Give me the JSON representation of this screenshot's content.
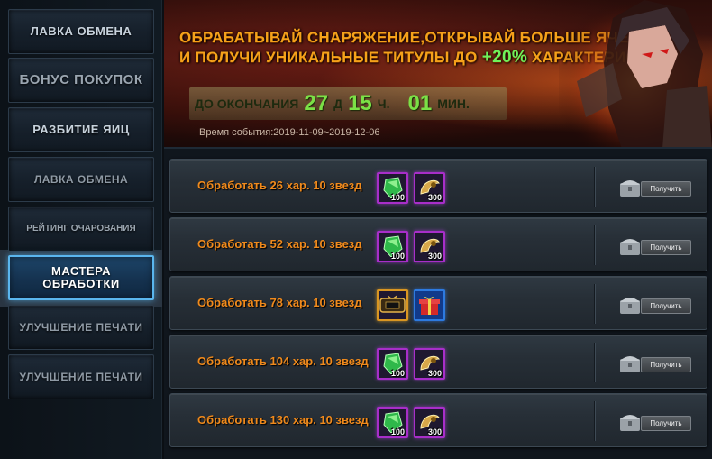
{
  "sidebar": {
    "items": [
      {
        "label": "ЛАВКА ОБМЕНА"
      },
      {
        "label": "БОНУС ПОКУПОК"
      },
      {
        "label": "РАЗБИТИЕ ЯИЦ"
      },
      {
        "label": "ЛАВКА ОБМЕНА"
      },
      {
        "label": "РЕЙТИНГ ОЧАРОВАНИЯ"
      },
      {
        "label": "МАСТЕРА ОБРАБОТКИ"
      },
      {
        "label": "УЛУЧШЕНИЕ ПЕЧАТИ"
      },
      {
        "label": "УЛУЧШЕНИЕ ПЕЧАТИ"
      }
    ],
    "active_index": 5
  },
  "banner": {
    "line1": "ОБРАБАТЫВАЙ СНАРЯЖЕНИЕ,ОТКРЫВАЙ БОЛЬШЕ ЯЧЕЕК",
    "line2_prefix": "И ПОЛУЧИ УНИКАЛЬНЫЕ  ТИТУЛЫ ДО ",
    "line2_pct": "+20%",
    "line2_suffix": " ХАРАКТЕРИСТИК!",
    "timer": {
      "label": "ДО ОКОНЧАНИЯ",
      "days": "27",
      "days_unit": "Д",
      "hours": "15",
      "hours_unit": "Ч.",
      "minutes": "01",
      "minutes_unit": "МИН."
    },
    "event_time": "Время события:2019-11-09~2019-12-06"
  },
  "tasks": [
    {
      "label": "Обработать 26 хар. 10 звезд",
      "rewards": [
        {
          "icon": "green-gem-icon",
          "count": "100"
        },
        {
          "icon": "golden-horn-icon",
          "count": "300"
        }
      ],
      "button": "Получить"
    },
    {
      "label": "Обработать 52 хар. 10 звезд",
      "rewards": [
        {
          "icon": "green-gem-icon",
          "count": "100"
        },
        {
          "icon": "golden-horn-icon",
          "count": "300"
        }
      ],
      "button": "Получить"
    },
    {
      "label": "Обработать 78 хар. 10 звезд",
      "rewards": [
        {
          "icon": "title-badge-icon",
          "count": ""
        },
        {
          "icon": "gift-box-icon",
          "count": ""
        }
      ],
      "button": "Получить"
    },
    {
      "label": "Обработать 104 хар. 10 звезд",
      "rewards": [
        {
          "icon": "green-gem-icon",
          "count": "100"
        },
        {
          "icon": "golden-horn-icon",
          "count": "300"
        }
      ],
      "button": "Получить"
    },
    {
      "label": "Обработать 130 хар. 10 звезд",
      "rewards": [
        {
          "icon": "green-gem-icon",
          "count": "100"
        },
        {
          "icon": "golden-horn-icon",
          "count": "300"
        }
      ],
      "button": "Получить"
    }
  ],
  "colors": {
    "accent_orange": "#f5a21a",
    "task_text": "#f08a1c",
    "timer_green": "#7be046",
    "active_border": "#5ab6ee"
  }
}
